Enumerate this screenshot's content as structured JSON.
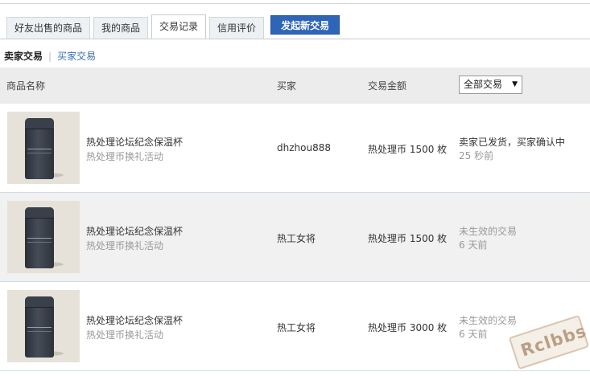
{
  "tabs": [
    {
      "label": "好友出售的商品",
      "active": false
    },
    {
      "label": "我的商品",
      "active": false
    },
    {
      "label": "交易记录",
      "active": true
    },
    {
      "label": "信用评价",
      "active": false
    }
  ],
  "new_trade_button": "发起新交易",
  "subnav": {
    "current": "卖家交易",
    "separator": "|",
    "other": "买家交易"
  },
  "table": {
    "headers": {
      "product": "商品名称",
      "buyer": "买家",
      "amount": "交易金额"
    },
    "filter": {
      "selected": "全部交易",
      "arrow": "▼"
    },
    "rows": [
      {
        "product_name": "热处理论坛纪念保温杯",
        "product_sub": "热处理币换礼活动",
        "buyer": "dhzhou888",
        "amount": "热处理币 1500 枚",
        "status": "卖家已发货，买家确认中",
        "time": "25 秒前"
      },
      {
        "product_name": "热处理论坛纪念保温杯",
        "product_sub": "热处理币换礼活动",
        "buyer": "热工女将",
        "amount": "热处理币 1500 枚",
        "status": "未生效的交易",
        "time": "6 天前"
      },
      {
        "product_name": "热处理论坛纪念保温杯",
        "product_sub": "热处理币换礼活动",
        "buyer": "热工女将",
        "amount": "热处理币 3000 枚",
        "status": "未生效的交易",
        "time": "6 天前"
      }
    ]
  },
  "watermark": "Rclbbs",
  "colors": {
    "primary_button": "#2f65b7",
    "link": "#3a6fb0",
    "header_bg": "#ececec",
    "alt_row_bg": "#f1f1f1"
  }
}
